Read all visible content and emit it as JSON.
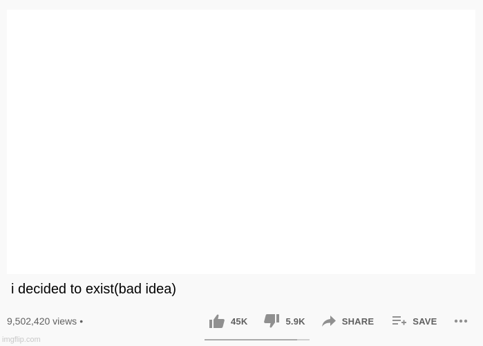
{
  "video": {
    "title": "i decided to exist(bad idea)",
    "views": "9,502,420 views",
    "separator": "•"
  },
  "actions": {
    "like": {
      "icon": "thumbs-up-icon",
      "label": "45K"
    },
    "dislike": {
      "icon": "thumbs-down-icon",
      "label": "5.9K"
    },
    "share": {
      "icon": "share-arrow-icon",
      "label": "SHARE"
    },
    "save": {
      "icon": "playlist-add-icon",
      "label": "SAVE"
    },
    "more": {
      "icon": "more-horizontal-icon"
    }
  },
  "sentiment": {
    "like_ratio": 0.88
  },
  "watermark": "imgflip.com"
}
